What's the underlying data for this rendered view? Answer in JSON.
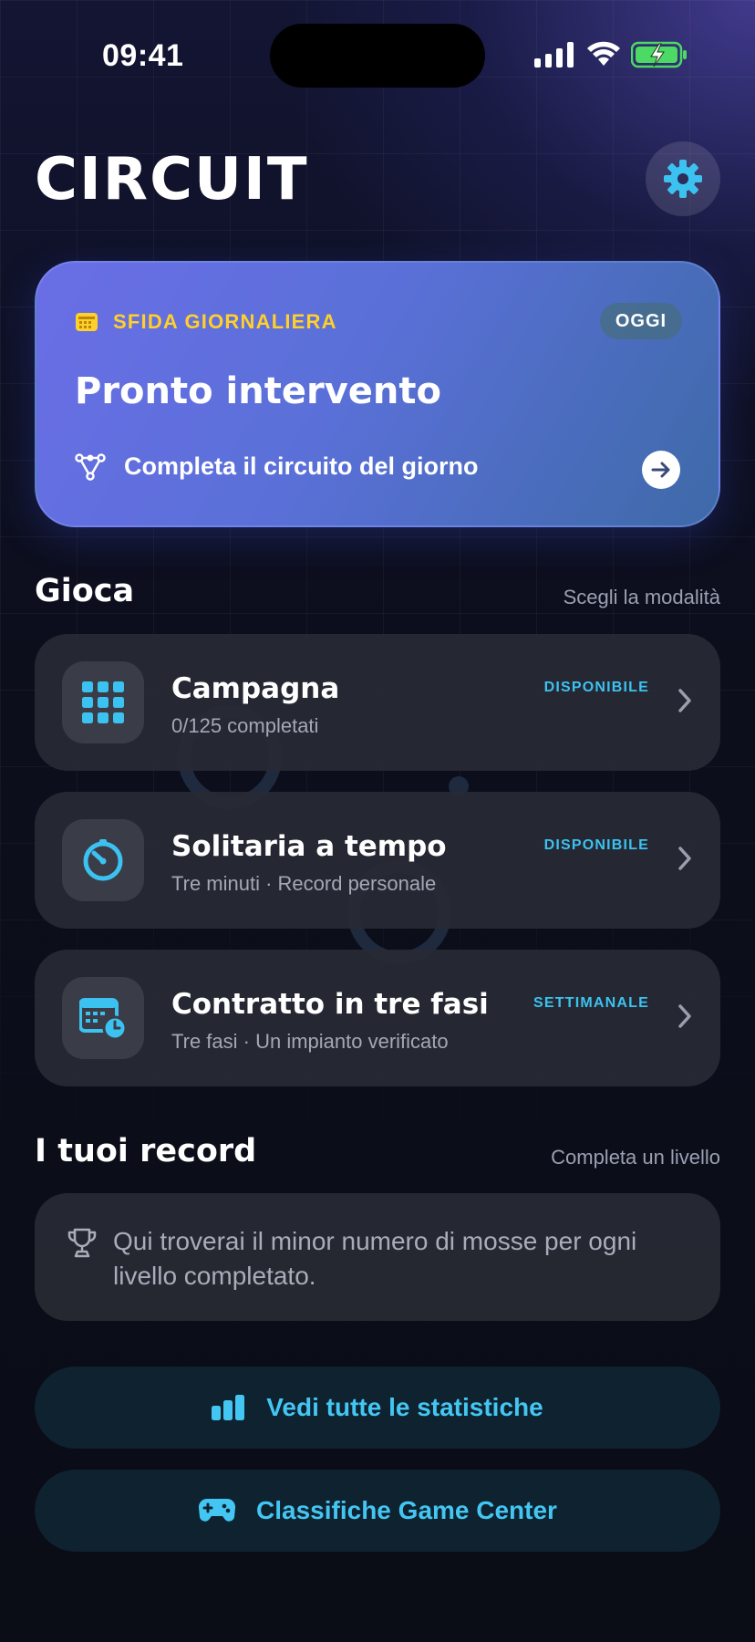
{
  "status_bar": {
    "time": "09:41"
  },
  "header": {
    "app_title": "CIRCUIT"
  },
  "daily_challenge": {
    "tag": "SFIDA GIORNALIERA",
    "badge": "OGGI",
    "title": "Pronto intervento",
    "subtitle": "Completa il circuito del giorno",
    "accent_color": "#ffd02a"
  },
  "play_section": {
    "title": "Gioca",
    "hint": "Scegli la modalità",
    "modes": [
      {
        "icon": "grid-icon",
        "title": "Campagna",
        "subtitle": "0/125 completati",
        "badge": "DISPONIBILE"
      },
      {
        "icon": "timer-icon",
        "title": "Solitaria a tempo",
        "subtitle": "Tre minuti · Record personale",
        "badge": "DISPONIBILE"
      },
      {
        "icon": "calendar-clock-icon",
        "title": "Contratto in tre fasi",
        "subtitle": "Tre fasi · Un impianto verificato",
        "badge": "SETTIMANALE"
      }
    ]
  },
  "records_section": {
    "title": "I tuoi record",
    "hint": "Completa un livello",
    "empty_text": "Qui troverai il minor numero di mosse per ogni livello completato."
  },
  "actions": {
    "stats_label": "Vedi tutte le statistiche",
    "leaderboard_label": "Classifiche Game Center"
  },
  "colors": {
    "accent": "#3cc2f0",
    "battery": "#4cd964"
  }
}
